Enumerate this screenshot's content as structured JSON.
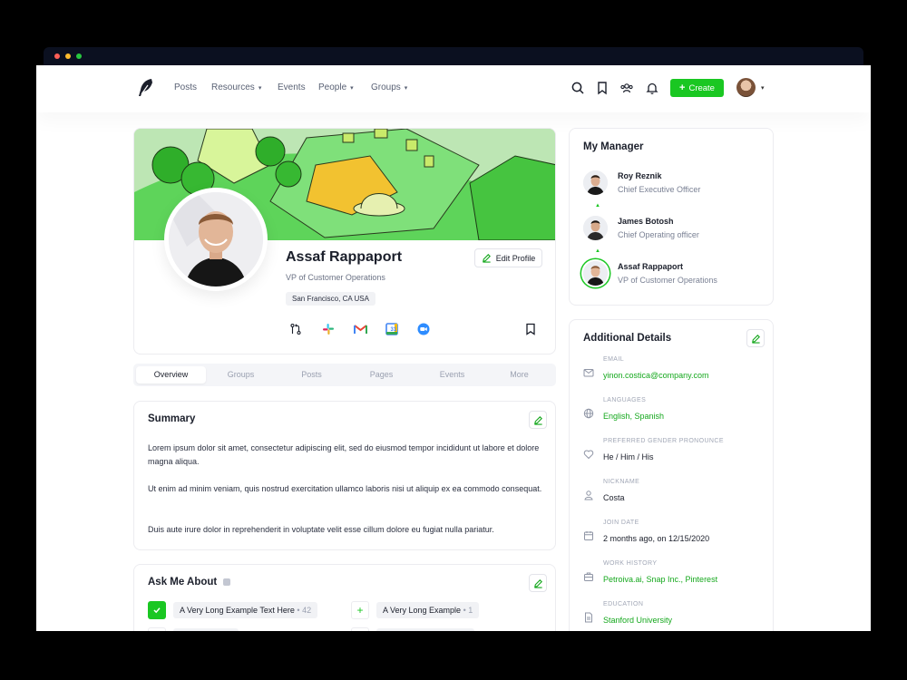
{
  "colors": {
    "accent": "#1ac722",
    "link": "#15a81d",
    "dot_red": "#ff5f57",
    "dot_yellow": "#febc2e",
    "dot_green": "#28c840"
  },
  "nav": {
    "items": [
      "Posts",
      "Resources",
      "Events",
      "People",
      "Groups"
    ],
    "icons": [
      "search-icon",
      "bookmark-icon",
      "people-icon",
      "bell-icon"
    ],
    "create_label": "Create"
  },
  "profile": {
    "name": "Assaf Rappaport",
    "title": "VP of Customer Operations",
    "location": "San Francisco, CA USA",
    "edit_label": "Edit Profile",
    "integrations": [
      "git-icon",
      "slack-icon",
      "gmail-icon",
      "google-calendar-icon",
      "zoom-icon"
    ]
  },
  "tabs": [
    "Overview",
    "Groups",
    "Posts",
    "Pages",
    "Events",
    "More"
  ],
  "active_tab": "Overview",
  "summary": {
    "title": "Summary",
    "paragraphs": [
      "Lorem ipsum dolor sit amet, consectetur adipiscing elit, sed do eiusmod tempor incididunt ut labore et dolore magna aliqua.",
      "Ut enim ad minim veniam, quis nostrud exercitation ullamco laboris nisi ut aliquip ex ea commodo consequat.",
      "Duis aute irure dolor in reprehenderit in voluptate velit esse cillum dolore eu fugiat nulla pariatur."
    ]
  },
  "ask": {
    "title": "Ask Me About",
    "items": [
      {
        "text": "A Very Long Example Text Here",
        "count": "42",
        "checked": true
      },
      {
        "text": "A Very Long Example",
        "count": "1",
        "checked": false
      }
    ]
  },
  "manager": {
    "title": "My Manager",
    "chain": [
      {
        "name": "Roy Reznik",
        "role": "Chief Executive Officer"
      },
      {
        "name": "James Botosh",
        "role": "Chief Operating officer"
      },
      {
        "name": "Assaf Rappaport",
        "role": "VP of Customer Operations"
      }
    ]
  },
  "details": {
    "title": "Additional Details",
    "items": [
      {
        "label": "EMAIL",
        "value": "yinon.costica@company.com",
        "icon": "mail-icon"
      },
      {
        "label": "LANGUAGES",
        "value": "English, Spanish",
        "icon": "globe-icon"
      },
      {
        "label": "PREFERRED GENDER PRONOUNCE",
        "value": "He / Him / His",
        "icon": "heart-icon"
      },
      {
        "label": "NICKNAME",
        "value": "Costa",
        "icon": "user-icon"
      },
      {
        "label": "JOIN DATE",
        "value": "2 months ago, on 12/15/2020",
        "icon": "calendar-icon"
      },
      {
        "label": "WORK HISTORY",
        "value": "Petroiva.ai, Snap Inc., Pinterest",
        "icon": "briefcase-icon"
      },
      {
        "label": "EDUCATION",
        "value": "Stanford University",
        "icon": "document-icon"
      }
    ]
  }
}
